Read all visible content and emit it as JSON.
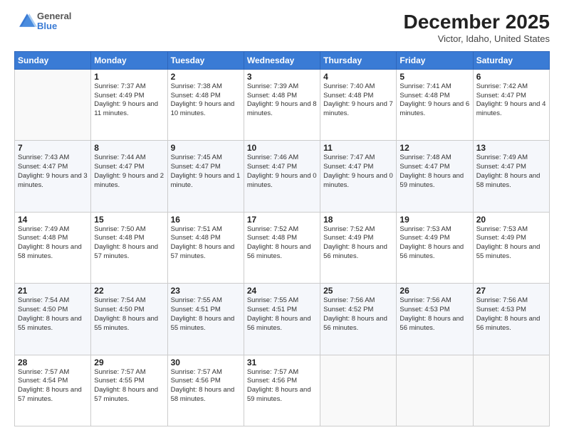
{
  "header": {
    "logo": {
      "general": "General",
      "blue": "Blue"
    },
    "title": "December 2025",
    "location": "Victor, Idaho, United States"
  },
  "calendar": {
    "weekdays": [
      "Sunday",
      "Monday",
      "Tuesday",
      "Wednesday",
      "Thursday",
      "Friday",
      "Saturday"
    ],
    "rows": [
      [
        {
          "day": "",
          "sunrise": "",
          "sunset": "",
          "daylight": ""
        },
        {
          "day": "1",
          "sunrise": "Sunrise: 7:37 AM",
          "sunset": "Sunset: 4:49 PM",
          "daylight": "Daylight: 9 hours and 11 minutes."
        },
        {
          "day": "2",
          "sunrise": "Sunrise: 7:38 AM",
          "sunset": "Sunset: 4:48 PM",
          "daylight": "Daylight: 9 hours and 10 minutes."
        },
        {
          "day": "3",
          "sunrise": "Sunrise: 7:39 AM",
          "sunset": "Sunset: 4:48 PM",
          "daylight": "Daylight: 9 hours and 8 minutes."
        },
        {
          "day": "4",
          "sunrise": "Sunrise: 7:40 AM",
          "sunset": "Sunset: 4:48 PM",
          "daylight": "Daylight: 9 hours and 7 minutes."
        },
        {
          "day": "5",
          "sunrise": "Sunrise: 7:41 AM",
          "sunset": "Sunset: 4:48 PM",
          "daylight": "Daylight: 9 hours and 6 minutes."
        },
        {
          "day": "6",
          "sunrise": "Sunrise: 7:42 AM",
          "sunset": "Sunset: 4:47 PM",
          "daylight": "Daylight: 9 hours and 4 minutes."
        }
      ],
      [
        {
          "day": "7",
          "sunrise": "Sunrise: 7:43 AM",
          "sunset": "Sunset: 4:47 PM",
          "daylight": "Daylight: 9 hours and 3 minutes."
        },
        {
          "day": "8",
          "sunrise": "Sunrise: 7:44 AM",
          "sunset": "Sunset: 4:47 PM",
          "daylight": "Daylight: 9 hours and 2 minutes."
        },
        {
          "day": "9",
          "sunrise": "Sunrise: 7:45 AM",
          "sunset": "Sunset: 4:47 PM",
          "daylight": "Daylight: 9 hours and 1 minute."
        },
        {
          "day": "10",
          "sunrise": "Sunrise: 7:46 AM",
          "sunset": "Sunset: 4:47 PM",
          "daylight": "Daylight: 9 hours and 0 minutes."
        },
        {
          "day": "11",
          "sunrise": "Sunrise: 7:47 AM",
          "sunset": "Sunset: 4:47 PM",
          "daylight": "Daylight: 9 hours and 0 minutes."
        },
        {
          "day": "12",
          "sunrise": "Sunrise: 7:48 AM",
          "sunset": "Sunset: 4:47 PM",
          "daylight": "Daylight: 8 hours and 59 minutes."
        },
        {
          "day": "13",
          "sunrise": "Sunrise: 7:49 AM",
          "sunset": "Sunset: 4:47 PM",
          "daylight": "Daylight: 8 hours and 58 minutes."
        }
      ],
      [
        {
          "day": "14",
          "sunrise": "Sunrise: 7:49 AM",
          "sunset": "Sunset: 4:48 PM",
          "daylight": "Daylight: 8 hours and 58 minutes."
        },
        {
          "day": "15",
          "sunrise": "Sunrise: 7:50 AM",
          "sunset": "Sunset: 4:48 PM",
          "daylight": "Daylight: 8 hours and 57 minutes."
        },
        {
          "day": "16",
          "sunrise": "Sunrise: 7:51 AM",
          "sunset": "Sunset: 4:48 PM",
          "daylight": "Daylight: 8 hours and 57 minutes."
        },
        {
          "day": "17",
          "sunrise": "Sunrise: 7:52 AM",
          "sunset": "Sunset: 4:48 PM",
          "daylight": "Daylight: 8 hours and 56 minutes."
        },
        {
          "day": "18",
          "sunrise": "Sunrise: 7:52 AM",
          "sunset": "Sunset: 4:49 PM",
          "daylight": "Daylight: 8 hours and 56 minutes."
        },
        {
          "day": "19",
          "sunrise": "Sunrise: 7:53 AM",
          "sunset": "Sunset: 4:49 PM",
          "daylight": "Daylight: 8 hours and 56 minutes."
        },
        {
          "day": "20",
          "sunrise": "Sunrise: 7:53 AM",
          "sunset": "Sunset: 4:49 PM",
          "daylight": "Daylight: 8 hours and 55 minutes."
        }
      ],
      [
        {
          "day": "21",
          "sunrise": "Sunrise: 7:54 AM",
          "sunset": "Sunset: 4:50 PM",
          "daylight": "Daylight: 8 hours and 55 minutes."
        },
        {
          "day": "22",
          "sunrise": "Sunrise: 7:54 AM",
          "sunset": "Sunset: 4:50 PM",
          "daylight": "Daylight: 8 hours and 55 minutes."
        },
        {
          "day": "23",
          "sunrise": "Sunrise: 7:55 AM",
          "sunset": "Sunset: 4:51 PM",
          "daylight": "Daylight: 8 hours and 55 minutes."
        },
        {
          "day": "24",
          "sunrise": "Sunrise: 7:55 AM",
          "sunset": "Sunset: 4:51 PM",
          "daylight": "Daylight: 8 hours and 56 minutes."
        },
        {
          "day": "25",
          "sunrise": "Sunrise: 7:56 AM",
          "sunset": "Sunset: 4:52 PM",
          "daylight": "Daylight: 8 hours and 56 minutes."
        },
        {
          "day": "26",
          "sunrise": "Sunrise: 7:56 AM",
          "sunset": "Sunset: 4:53 PM",
          "daylight": "Daylight: 8 hours and 56 minutes."
        },
        {
          "day": "27",
          "sunrise": "Sunrise: 7:56 AM",
          "sunset": "Sunset: 4:53 PM",
          "daylight": "Daylight: 8 hours and 56 minutes."
        }
      ],
      [
        {
          "day": "28",
          "sunrise": "Sunrise: 7:57 AM",
          "sunset": "Sunset: 4:54 PM",
          "daylight": "Daylight: 8 hours and 57 minutes."
        },
        {
          "day": "29",
          "sunrise": "Sunrise: 7:57 AM",
          "sunset": "Sunset: 4:55 PM",
          "daylight": "Daylight: 8 hours and 57 minutes."
        },
        {
          "day": "30",
          "sunrise": "Sunrise: 7:57 AM",
          "sunset": "Sunset: 4:56 PM",
          "daylight": "Daylight: 8 hours and 58 minutes."
        },
        {
          "day": "31",
          "sunrise": "Sunrise: 7:57 AM",
          "sunset": "Sunset: 4:56 PM",
          "daylight": "Daylight: 8 hours and 59 minutes."
        },
        {
          "day": "",
          "sunrise": "",
          "sunset": "",
          "daylight": ""
        },
        {
          "day": "",
          "sunrise": "",
          "sunset": "",
          "daylight": ""
        },
        {
          "day": "",
          "sunrise": "",
          "sunset": "",
          "daylight": ""
        }
      ]
    ]
  }
}
